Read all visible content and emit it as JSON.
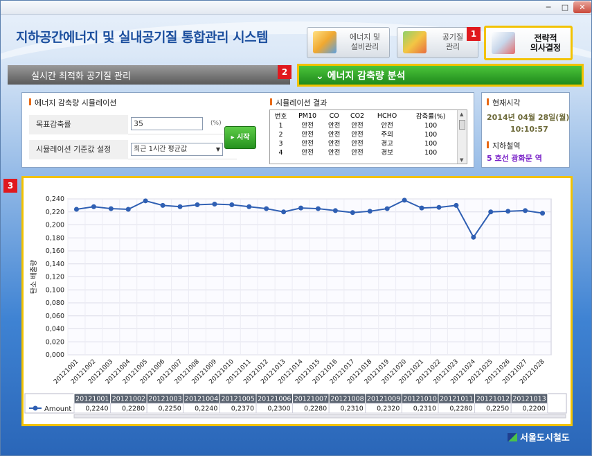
{
  "window": {
    "min": "─",
    "max": "□",
    "close": "✕"
  },
  "app_title": "지하공간에너지 및 실내공기질 통합관리 시스템",
  "nav": [
    {
      "label": "에너지 및\n설비관리",
      "icon": "energy-icon"
    },
    {
      "label": "공기질\n관리",
      "icon": "air-quality-icon"
    },
    {
      "label": "전략적\n의사결정",
      "icon": "decision-icon"
    }
  ],
  "badges": [
    "1",
    "2",
    "3"
  ],
  "subbar_title": "실시간 최적화 공기질 관리",
  "green_title": "⌄ 에너지 감축량 분석",
  "simulation": {
    "heading": "에너지 감축량 시뮬레이션",
    "target_label": "목표감축률",
    "target_value": "35",
    "target_unit": "(%)",
    "baseline_label": "시뮬레이션 기준값 설정",
    "baseline_value": "최근 1시간 평균값",
    "start_label": "▸ 시작"
  },
  "result": {
    "heading": "시뮬레이션 결과",
    "columns": [
      "번호",
      "PM10",
      "CO",
      "CO2",
      "HCHO",
      "감축률(%)"
    ],
    "rows": [
      [
        "1",
        "안전",
        "안전",
        "안전",
        "안전",
        "100"
      ],
      [
        "2",
        "안전",
        "안전",
        "안전",
        "주의",
        "100"
      ],
      [
        "3",
        "안전",
        "안전",
        "안전",
        "경고",
        "100"
      ],
      [
        "4",
        "안전",
        "안전",
        "안전",
        "경보",
        "100"
      ]
    ]
  },
  "info": {
    "time_heading": "현재시각",
    "date": "2014년  04월 28일(월)",
    "time": "10:10:57",
    "subway_heading": "지하철역",
    "station": "5 호선    광화문 역"
  },
  "chart_data": {
    "type": "line",
    "ylabel": "탄소 배출량",
    "ylim": [
      0.0,
      0.24
    ],
    "yticks": [
      "0,000",
      "0,020",
      "0,040",
      "0,060",
      "0,080",
      "0,100",
      "0,120",
      "0,140",
      "0,160",
      "0,180",
      "0,200",
      "0,220",
      "0,240"
    ],
    "categories": [
      "20121001",
      "20121002",
      "20121003",
      "20121004",
      "20121005",
      "20121006",
      "20121007",
      "20121008",
      "20121009",
      "20121010",
      "20121011",
      "20121012",
      "20121013",
      "20121014",
      "20121015",
      "20121016",
      "20121017",
      "20121018",
      "20121019",
      "20121020",
      "20121021",
      "20121022",
      "20121023",
      "20121024",
      "20121025",
      "20121026",
      "20121027",
      "20121028"
    ],
    "series": [
      {
        "name": "Amount",
        "values": [
          0.224,
          0.228,
          0.225,
          0.224,
          0.237,
          0.23,
          0.228,
          0.231,
          0.232,
          0.231,
          0.228,
          0.225,
          0.22,
          0.226,
          0.225,
          0.222,
          0.219,
          0.221,
          0.225,
          0.238,
          0.226,
          0.227,
          0.23,
          0.181,
          0.22,
          0.221,
          0.222,
          0.218
        ]
      }
    ],
    "table_headers": [
      "20121001",
      "20121002",
      "20121003",
      "20121004",
      "20121005",
      "20121006",
      "20121007",
      "20121008",
      "20121009",
      "20121010",
      "20121011",
      "20121012",
      "20121013"
    ],
    "table_values": [
      "0,2240",
      "0,2280",
      "0,2250",
      "0,2240",
      "0,2370",
      "0,2300",
      "0,2280",
      "0,2310",
      "0,2320",
      "0,2310",
      "0,2280",
      "0,2250",
      "0,2200"
    ],
    "grid": true,
    "legend": "bottom-left"
  },
  "footer_logo": "서울도시철도",
  "colors": {
    "line": "#2f5fb3",
    "highlight": "#f2c200",
    "green": "#2b9a25"
  }
}
